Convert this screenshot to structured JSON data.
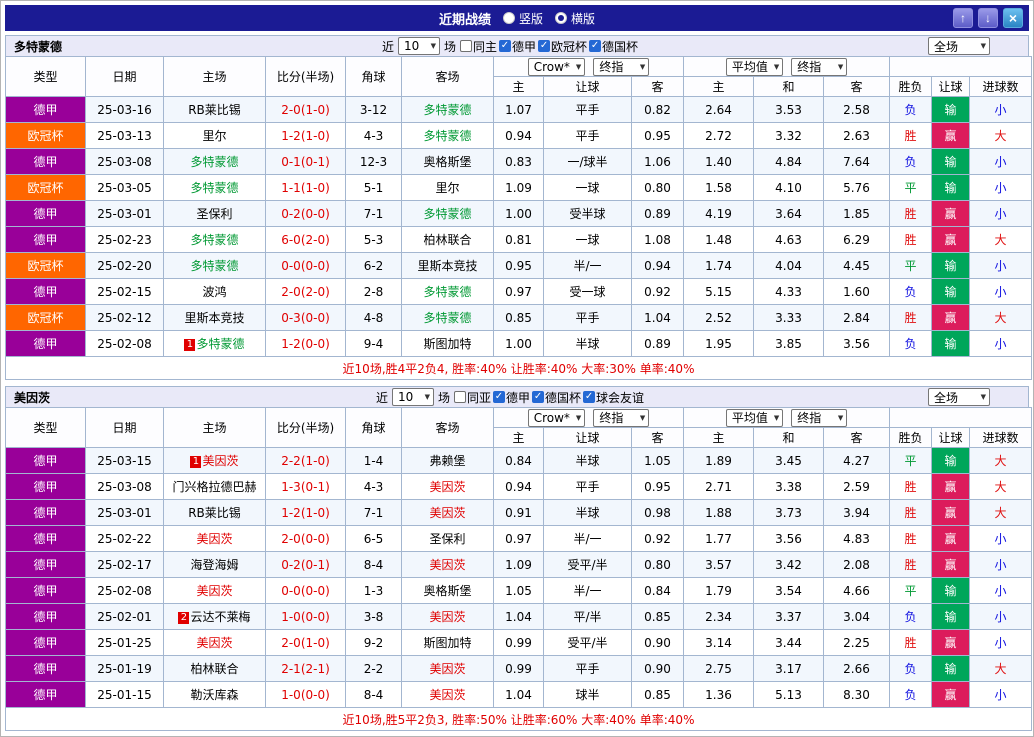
{
  "titlebar": {
    "title": "近期战绩",
    "radios": [
      {
        "label": "竖版",
        "selected": false
      },
      {
        "label": "横版",
        "selected": true
      }
    ]
  },
  "table_headers": {
    "left": [
      "类型",
      "日期",
      "主场",
      "比分(半场)",
      "角球",
      "客场"
    ],
    "sub": [
      "主",
      "让球",
      "客",
      "主",
      "和",
      "客",
      "胜负",
      "让球",
      "进球数"
    ]
  },
  "league_colors": {
    "德甲": "#990099",
    "欧冠杯": "#ff6600"
  },
  "colors": {
    "win": "#e01010",
    "draw": "#009933",
    "loss": "#1010e0",
    "handicap_win_bg": "#dc1c5c",
    "handicap_loss_bg": "#00a65a",
    "goals_over": "#e01010",
    "goals_under": "#1010e0",
    "score": "#e00000",
    "titlebar_bg": "#1b1b94"
  },
  "sections": [
    {
      "team": "多特蒙德",
      "team_color": "#009933",
      "filter": {
        "prefix": "近",
        "count": "10",
        "suffix": "场",
        "checkboxes": [
          {
            "label": "同主",
            "checked": false
          },
          {
            "label": "德甲",
            "checked": true
          },
          {
            "label": "欧冠杯",
            "checked": true
          },
          {
            "label": "德国杯",
            "checked": true
          }
        ]
      },
      "selects": {
        "odds_source": "Crow*",
        "odds_stage": "终指",
        "avg_source": "平均值",
        "avg_stage": "终指",
        "scope": "全场"
      },
      "rows": [
        {
          "league": "德甲",
          "date": "25-03-16",
          "home": "RB莱比锡",
          "home_focus": false,
          "home_rank": "",
          "score": "2-0(1-0)",
          "corner": "3-12",
          "away": "多特蒙德",
          "away_focus": true,
          "away_rank": "",
          "odds_home": "1.07",
          "handicap": "平手",
          "odds_away": "0.82",
          "avg_home": "2.64",
          "avg_draw": "3.53",
          "avg_away": "2.58",
          "result": "负",
          "handicap_result": "输",
          "goals": "小"
        },
        {
          "league": "欧冠杯",
          "date": "25-03-13",
          "home": "里尔",
          "home_focus": false,
          "home_rank": "",
          "score": "1-2(1-0)",
          "corner": "4-3",
          "away": "多特蒙德",
          "away_focus": true,
          "away_rank": "",
          "odds_home": "0.94",
          "handicap": "平手",
          "odds_away": "0.95",
          "avg_home": "2.72",
          "avg_draw": "3.32",
          "avg_away": "2.63",
          "result": "胜",
          "handicap_result": "赢",
          "goals": "大"
        },
        {
          "league": "德甲",
          "date": "25-03-08",
          "home": "多特蒙德",
          "home_focus": true,
          "home_rank": "",
          "score": "0-1(0-1)",
          "corner": "12-3",
          "away": "奥格斯堡",
          "away_focus": false,
          "away_rank": "",
          "odds_home": "0.83",
          "handicap": "一/球半",
          "odds_away": "1.06",
          "avg_home": "1.40",
          "avg_draw": "4.84",
          "avg_away": "7.64",
          "result": "负",
          "handicap_result": "输",
          "goals": "小"
        },
        {
          "league": "欧冠杯",
          "date": "25-03-05",
          "home": "多特蒙德",
          "home_focus": true,
          "home_rank": "",
          "score": "1-1(1-0)",
          "corner": "5-1",
          "away": "里尔",
          "away_focus": false,
          "away_rank": "",
          "odds_home": "1.09",
          "handicap": "一球",
          "odds_away": "0.80",
          "avg_home": "1.58",
          "avg_draw": "4.10",
          "avg_away": "5.76",
          "result": "平",
          "handicap_result": "输",
          "goals": "小"
        },
        {
          "league": "德甲",
          "date": "25-03-01",
          "home": "圣保利",
          "home_focus": false,
          "home_rank": "",
          "score": "0-2(0-0)",
          "corner": "7-1",
          "away": "多特蒙德",
          "away_focus": true,
          "away_rank": "",
          "odds_home": "1.00",
          "handicap": "受半球",
          "odds_away": "0.89",
          "avg_home": "4.19",
          "avg_draw": "3.64",
          "avg_away": "1.85",
          "result": "胜",
          "handicap_result": "赢",
          "goals": "小"
        },
        {
          "league": "德甲",
          "date": "25-02-23",
          "home": "多特蒙德",
          "home_focus": true,
          "home_rank": "",
          "score": "6-0(2-0)",
          "corner": "5-3",
          "away": "柏林联合",
          "away_focus": false,
          "away_rank": "",
          "odds_home": "0.81",
          "handicap": "一球",
          "odds_away": "1.08",
          "avg_home": "1.48",
          "avg_draw": "4.63",
          "avg_away": "6.29",
          "result": "胜",
          "handicap_result": "赢",
          "goals": "大"
        },
        {
          "league": "欧冠杯",
          "date": "25-02-20",
          "home": "多特蒙德",
          "home_focus": true,
          "home_rank": "",
          "score": "0-0(0-0)",
          "corner": "6-2",
          "away": "里斯本竞技",
          "away_focus": false,
          "away_rank": "",
          "odds_home": "0.95",
          "handicap": "半/一",
          "odds_away": "0.94",
          "avg_home": "1.74",
          "avg_draw": "4.04",
          "avg_away": "4.45",
          "result": "平",
          "handicap_result": "输",
          "goals": "小"
        },
        {
          "league": "德甲",
          "date": "25-02-15",
          "home": "波鸿",
          "home_focus": false,
          "home_rank": "",
          "score": "2-0(2-0)",
          "corner": "2-8",
          "away": "多特蒙德",
          "away_focus": true,
          "away_rank": "",
          "odds_home": "0.97",
          "handicap": "受一球",
          "odds_away": "0.92",
          "avg_home": "5.15",
          "avg_draw": "4.33",
          "avg_away": "1.60",
          "result": "负",
          "handicap_result": "输",
          "goals": "小"
        },
        {
          "league": "欧冠杯",
          "date": "25-02-12",
          "home": "里斯本竞技",
          "home_focus": false,
          "home_rank": "",
          "score": "0-3(0-0)",
          "corner": "4-8",
          "away": "多特蒙德",
          "away_focus": true,
          "away_rank": "",
          "odds_home": "0.85",
          "handicap": "平手",
          "odds_away": "1.04",
          "avg_home": "2.52",
          "avg_draw": "3.33",
          "avg_away": "2.84",
          "result": "胜",
          "handicap_result": "赢",
          "goals": "大"
        },
        {
          "league": "德甲",
          "date": "25-02-08",
          "home": "多特蒙德",
          "home_focus": true,
          "home_rank": "1",
          "score": "1-2(0-0)",
          "corner": "9-4",
          "away": "斯图加特",
          "away_focus": false,
          "away_rank": "",
          "odds_home": "1.00",
          "handicap": "半球",
          "odds_away": "0.89",
          "avg_home": "1.95",
          "avg_draw": "3.85",
          "avg_away": "3.56",
          "result": "负",
          "handicap_result": "输",
          "goals": "小"
        }
      ],
      "summary": "近10场,胜4平2负4, 胜率:40% 让胜率:40% 大率:30% 单率:40%"
    },
    {
      "team": "美因茨",
      "team_color": "#e00000",
      "filter": {
        "prefix": "近",
        "count": "10",
        "suffix": "场",
        "checkboxes": [
          {
            "label": "同亚",
            "checked": false
          },
          {
            "label": "德甲",
            "checked": true
          },
          {
            "label": "德国杯",
            "checked": true
          },
          {
            "label": "球会友谊",
            "checked": true
          }
        ]
      },
      "selects": {
        "odds_source": "Crow*",
        "odds_stage": "终指",
        "avg_source": "平均值",
        "avg_stage": "终指",
        "scope": "全场"
      },
      "rows": [
        {
          "league": "德甲",
          "date": "25-03-15",
          "home": "美因茨",
          "home_focus": true,
          "home_rank": "1",
          "score": "2-2(1-0)",
          "corner": "1-4",
          "away": "弗赖堡",
          "away_focus": false,
          "away_rank": "",
          "odds_home": "0.84",
          "handicap": "半球",
          "odds_away": "1.05",
          "avg_home": "1.89",
          "avg_draw": "3.45",
          "avg_away": "4.27",
          "result": "平",
          "handicap_result": "输",
          "goals": "大"
        },
        {
          "league": "德甲",
          "date": "25-03-08",
          "home": "门兴格拉德巴赫",
          "home_focus": false,
          "home_rank": "",
          "score": "1-3(0-1)",
          "corner": "4-3",
          "away": "美因茨",
          "away_focus": true,
          "away_rank": "",
          "odds_home": "0.94",
          "handicap": "平手",
          "odds_away": "0.95",
          "avg_home": "2.71",
          "avg_draw": "3.38",
          "avg_away": "2.59",
          "result": "胜",
          "handicap_result": "赢",
          "goals": "大"
        },
        {
          "league": "德甲",
          "date": "25-03-01",
          "home": "RB莱比锡",
          "home_focus": false,
          "home_rank": "",
          "score": "1-2(1-0)",
          "corner": "7-1",
          "away": "美因茨",
          "away_focus": true,
          "away_rank": "",
          "odds_home": "0.91",
          "handicap": "半球",
          "odds_away": "0.98",
          "avg_home": "1.88",
          "avg_draw": "3.73",
          "avg_away": "3.94",
          "result": "胜",
          "handicap_result": "赢",
          "goals": "大"
        },
        {
          "league": "德甲",
          "date": "25-02-22",
          "home": "美因茨",
          "home_focus": true,
          "home_rank": "",
          "score": "2-0(0-0)",
          "corner": "6-5",
          "away": "圣保利",
          "away_focus": false,
          "away_rank": "",
          "odds_home": "0.97",
          "handicap": "半/一",
          "odds_away": "0.92",
          "avg_home": "1.77",
          "avg_draw": "3.56",
          "avg_away": "4.83",
          "result": "胜",
          "handicap_result": "赢",
          "goals": "小"
        },
        {
          "league": "德甲",
          "date": "25-02-17",
          "home": "海登海姆",
          "home_focus": false,
          "home_rank": "",
          "score": "0-2(0-1)",
          "corner": "8-4",
          "away": "美因茨",
          "away_focus": true,
          "away_rank": "",
          "odds_home": "1.09",
          "handicap": "受平/半",
          "odds_away": "0.80",
          "avg_home": "3.57",
          "avg_draw": "3.42",
          "avg_away": "2.08",
          "result": "胜",
          "handicap_result": "赢",
          "goals": "小"
        },
        {
          "league": "德甲",
          "date": "25-02-08",
          "home": "美因茨",
          "home_focus": true,
          "home_rank": "",
          "score": "0-0(0-0)",
          "corner": "1-3",
          "away": "奥格斯堡",
          "away_focus": false,
          "away_rank": "",
          "odds_home": "1.05",
          "handicap": "半/一",
          "odds_away": "0.84",
          "avg_home": "1.79",
          "avg_draw": "3.54",
          "avg_away": "4.66",
          "result": "平",
          "handicap_result": "输",
          "goals": "小"
        },
        {
          "league": "德甲",
          "date": "25-02-01",
          "home": "云达不莱梅",
          "home_focus": false,
          "home_rank": "2",
          "score": "1-0(0-0)",
          "corner": "3-8",
          "away": "美因茨",
          "away_focus": true,
          "away_rank": "",
          "odds_home": "1.04",
          "handicap": "平/半",
          "odds_away": "0.85",
          "avg_home": "2.34",
          "avg_draw": "3.37",
          "avg_away": "3.04",
          "result": "负",
          "handicap_result": "输",
          "goals": "小"
        },
        {
          "league": "德甲",
          "date": "25-01-25",
          "home": "美因茨",
          "home_focus": true,
          "home_rank": "",
          "score": "2-0(1-0)",
          "corner": "9-2",
          "away": "斯图加特",
          "away_focus": false,
          "away_rank": "",
          "odds_home": "0.99",
          "handicap": "受平/半",
          "odds_away": "0.90",
          "avg_home": "3.14",
          "avg_draw": "3.44",
          "avg_away": "2.25",
          "result": "胜",
          "handicap_result": "赢",
          "goals": "小"
        },
        {
          "league": "德甲",
          "date": "25-01-19",
          "home": "柏林联合",
          "home_focus": false,
          "home_rank": "",
          "score": "2-1(2-1)",
          "corner": "2-2",
          "away": "美因茨",
          "away_focus": true,
          "away_rank": "",
          "odds_home": "0.99",
          "handicap": "平手",
          "odds_away": "0.90",
          "avg_home": "2.75",
          "avg_draw": "3.17",
          "avg_away": "2.66",
          "result": "负",
          "handicap_result": "输",
          "goals": "大"
        },
        {
          "league": "德甲",
          "date": "25-01-15",
          "home": "勒沃库森",
          "home_focus": false,
          "home_rank": "",
          "score": "1-0(0-0)",
          "corner": "8-4",
          "away": "美因茨",
          "away_focus": true,
          "away_rank": "",
          "odds_home": "1.04",
          "handicap": "球半",
          "odds_away": "0.85",
          "avg_home": "1.36",
          "avg_draw": "5.13",
          "avg_away": "8.30",
          "result": "负",
          "handicap_result": "赢",
          "goals": "小"
        }
      ],
      "summary": "近10场,胜5平2负3, 胜率:50% 让胜率:60% 大率:40% 单率:40%"
    }
  ]
}
